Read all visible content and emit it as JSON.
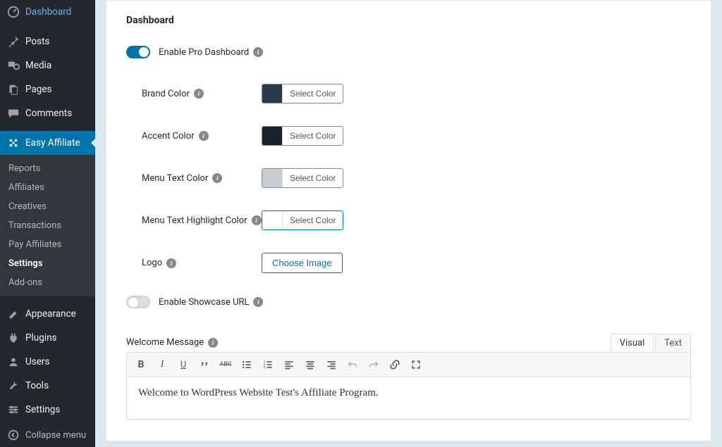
{
  "sidebar": {
    "items": [
      {
        "label": "Dashboard",
        "icon": "dashboard"
      },
      {
        "label": "Posts",
        "icon": "pin"
      },
      {
        "label": "Media",
        "icon": "media"
      },
      {
        "label": "Pages",
        "icon": "pages"
      },
      {
        "label": "Comments",
        "icon": "comments"
      },
      {
        "label": "Easy Affiliate",
        "icon": "affiliate"
      },
      {
        "label": "Appearance",
        "icon": "appearance"
      },
      {
        "label": "Plugins",
        "icon": "plugins"
      },
      {
        "label": "Users",
        "icon": "users"
      },
      {
        "label": "Tools",
        "icon": "tools"
      },
      {
        "label": "Settings",
        "icon": "settings"
      }
    ],
    "submenu": [
      "Reports",
      "Affiliates",
      "Creatives",
      "Transactions",
      "Pay Affiliates",
      "Settings",
      "Add-ons"
    ],
    "collapse": "Collapse menu"
  },
  "panel": {
    "title": "Dashboard",
    "enable_pro": "Enable Pro Dashboard",
    "fields": {
      "brand_color": {
        "label": "Brand Color",
        "swatch": "#2a3a4a",
        "btn": "Select Color"
      },
      "accent_color": {
        "label": "Accent Color",
        "swatch": "#1a222a",
        "btn": "Select Color"
      },
      "menu_text": {
        "label": "Menu Text Color",
        "swatch": "#c9cdd1",
        "btn": "Select Color"
      },
      "menu_hl": {
        "label": "Menu Text Highlight Color",
        "swatch": "#ffffff",
        "btn": "Select Color"
      },
      "logo": {
        "label": "Logo",
        "btn": "Choose Image"
      }
    },
    "enable_showcase": "Enable Showcase URL",
    "welcome_label": "Welcome Message",
    "tabs": {
      "visual": "Visual",
      "text": "Text"
    },
    "editor_content": "Welcome to WordPress Website Test's Affiliate Program."
  }
}
